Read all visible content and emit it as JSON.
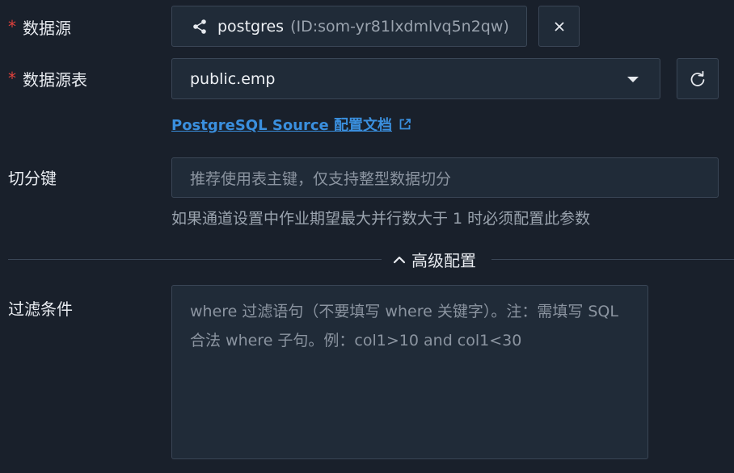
{
  "form": {
    "datasource": {
      "label": "数据源",
      "required_mark": "*",
      "name": "postgres",
      "id_text": "(ID:som-yr81lxdmlvq5n2qw)",
      "icon": "connection-icon",
      "clear_icon": "close-icon"
    },
    "table": {
      "label": "数据源表",
      "required_mark": "*",
      "value": "public.emp",
      "refresh_icon": "refresh-icon"
    },
    "doc_link": {
      "text": "PostgreSQL Source 配置文档",
      "icon": "external-link-icon"
    },
    "split_key": {
      "label": "切分键",
      "placeholder": "推荐使用表主键，仅支持整型数据切分",
      "help": "如果通道设置中作业期望最大并行数大于 1 时必须配置此参数"
    },
    "advanced": {
      "label": "高级配置",
      "icon": "chevron-up-icon"
    },
    "filter": {
      "label": "过滤条件",
      "placeholder": "where 过滤语句（不要填写 where 关键字）。注：需填写 SQL 合法 where 子句。例：col1>10 and col1<30"
    }
  },
  "colors": {
    "background": "#19202b",
    "input_bg": "#202b38",
    "border": "#3a4656",
    "link": "#3a8fde",
    "required": "#e0413c"
  }
}
